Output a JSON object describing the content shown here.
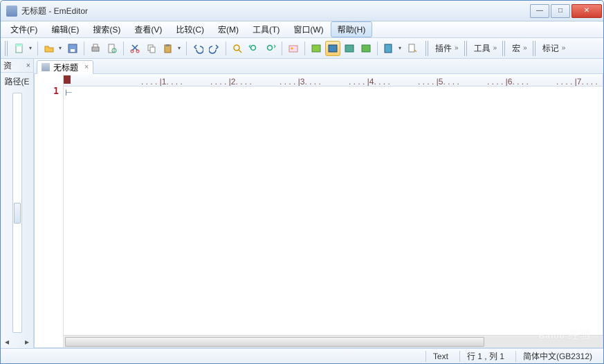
{
  "window": {
    "title": "无标题 - EmEditor"
  },
  "menus": {
    "file": "文件(F)",
    "edit": "编辑(E)",
    "search": "搜索(S)",
    "view": "查看(V)",
    "compare": "比较(C)",
    "macro": "宏(M)",
    "tools": "工具(T)",
    "window": "窗口(W)",
    "help": "帮助(H)"
  },
  "toolbar_tabs": {
    "plugins": "插件",
    "tools": "工具",
    "macro": "宏",
    "markers": "标记"
  },
  "sidebar": {
    "title": "资",
    "label": "路径(E"
  },
  "tab": {
    "label": "无标题"
  },
  "editor": {
    "line_number": "1"
  },
  "status": {
    "type": "Text",
    "cursor": "行 1 , 列 1",
    "encoding": "简体中文(GB2312)"
  },
  "icons": {
    "new": "new-file-icon",
    "open": "open-file-icon",
    "save": "save-icon",
    "print": "print-icon",
    "preview": "preview-icon",
    "cut": "cut-icon",
    "copy": "copy-icon",
    "paste": "paste-icon",
    "undo": "undo-icon",
    "redo": "redo-icon",
    "find": "find-icon",
    "find-prev": "find-prev-icon",
    "find-next": "find-next-icon",
    "browse": "browse-icon",
    "wrap-none": "wrap-none-icon",
    "wrap-window": "wrap-window-icon",
    "wrap-page": "wrap-page-icon",
    "wrap-col": "wrap-col-icon",
    "config": "config-icon",
    "props": "props-icon"
  },
  "ruler": {
    "ticks": [
      1,
      2,
      3,
      4,
      5,
      6,
      7
    ]
  },
  "watermark": {
    "brand": "Baidu",
    "sub": "经验"
  }
}
